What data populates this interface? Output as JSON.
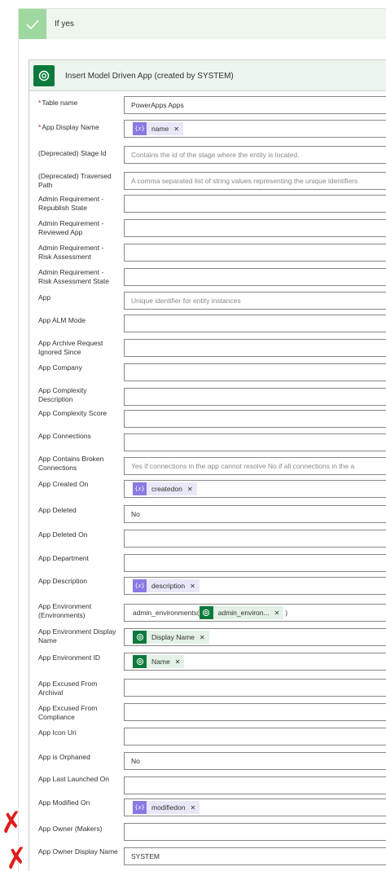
{
  "condition": {
    "label": "If yes"
  },
  "action": {
    "title": "Insert Model Driven App (created by SYSTEM)"
  },
  "fields": [
    {
      "label": "Table name",
      "required": true,
      "value": "PowerApps Apps"
    },
    {
      "label": "App Display Name",
      "required": true,
      "token": {
        "text": "name",
        "icon": "expression-icon"
      }
    },
    {
      "label": "(Deprecated) Stage Id",
      "placeholder": "Contains the id of the stage where the entity is located."
    },
    {
      "label": "(Deprecated) Traversed Path",
      "placeholder": "A comma separated list of string values representing the unique identifiers"
    },
    {
      "label": "Admin Requirement - Republish State"
    },
    {
      "label": "Admin Requirement - Reviewed App"
    },
    {
      "label": "Admin Requirement - Risk Assessment"
    },
    {
      "label": "Admin Requirement - Risk Assessment State"
    },
    {
      "label": "App",
      "placeholder": "Unique identifier for entity instances"
    },
    {
      "label": "App ALM Mode"
    },
    {
      "label": "App Archive Request Ignored Since"
    },
    {
      "label": "App Company"
    },
    {
      "label": "App Complexity Description"
    },
    {
      "label": "App Complexity Score"
    },
    {
      "label": "App Connections"
    },
    {
      "label": "App Contains Broken Connections",
      "placeholder": "Yes if connections in the app cannot resolve No if all connections in the a"
    },
    {
      "label": "App Created On",
      "token": {
        "text": "createdon",
        "icon": "expression-icon"
      }
    },
    {
      "label": "App Deleted",
      "value": "No"
    },
    {
      "label": "App Deleted On"
    },
    {
      "label": "App Department"
    },
    {
      "label": "App Description",
      "token": {
        "text": "description",
        "icon": "expression-icon"
      }
    },
    {
      "label": "App Environment (Environments)",
      "prefix": "admin_environments(",
      "token": {
        "text": "admin_environ...",
        "icon": "dataverse-icon"
      },
      "suffix": ")"
    },
    {
      "label": "App Environment Display Name",
      "token": {
        "text": "Display Name",
        "icon": "dataverse-icon"
      }
    },
    {
      "label": "App Environment ID",
      "token": {
        "text": "Name",
        "icon": "dataverse-icon"
      }
    },
    {
      "label": "App Excused From Archival"
    },
    {
      "label": "App Excused From Compliance"
    },
    {
      "label": "App Icon Uri"
    },
    {
      "label": "App is Orphaned",
      "value": "No"
    },
    {
      "label": "App Last Launched On"
    },
    {
      "label": "App Modified On",
      "token": {
        "text": "modifiedon",
        "icon": "expression-icon"
      }
    },
    {
      "label": "App Owner (Makers)"
    },
    {
      "label": "App Owner Display Name",
      "value": "SYSTEM"
    }
  ],
  "annotations": {
    "mark_color": "#e01b1b"
  },
  "colors": {
    "expression_token": "#8b79e4",
    "dataverse": "#0c7a3c",
    "condition_bg": "#eef6ee"
  }
}
